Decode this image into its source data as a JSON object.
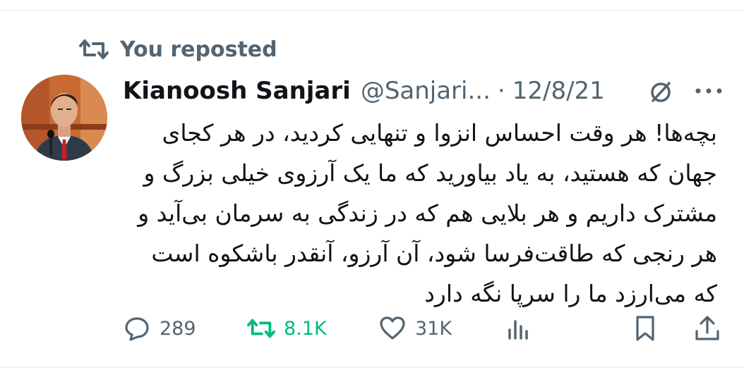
{
  "repost_bar": {
    "label": "You reposted"
  },
  "author": {
    "display_name": "Kianoosh Sanjari",
    "handle": "@Sanjari...",
    "separator": "·",
    "date": "12/8/21"
  },
  "tweet": {
    "text": "بچه‌ها! هر وقت احساس انزوا و تنهایی کردید، در هر کجای جهان که هستید، به یاد بیاورید که ما یک آرزوی خیلی بزرگ و مشترک داریم و هر بلایی هم که در زندگی به سرمان بی‌آید و هر رنجی که طاقت‌فرسا شود، آن آرزو، آنقدر باشکوه است که می‌ارزد ما را سرپا نگه دارد"
  },
  "actions": {
    "replies": "289",
    "reposts": "8.1K",
    "likes": "31K"
  },
  "colors": {
    "text_primary": "#0f1419",
    "text_secondary": "#536471",
    "repost_active": "#00ba7c",
    "divider": "#eff3f4"
  },
  "icons": [
    "repost-icon",
    "grok-icon",
    "more-icon",
    "reply-icon",
    "like-icon",
    "views-icon",
    "bookmark-icon",
    "share-icon"
  ]
}
